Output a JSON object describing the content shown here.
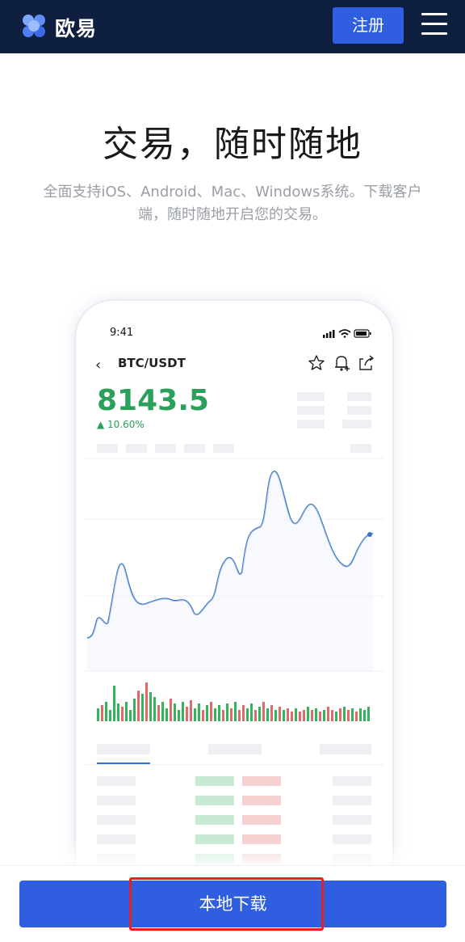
{
  "header": {
    "logo_text": "欧易",
    "register_label": "注册",
    "menu_icon": "hamburger-menu-icon"
  },
  "hero": {
    "title": "交易，随时随地",
    "subtitle": "全面支持iOS、Android、Mac、Windows系统。下载客户端，随时随地开启您的交易。"
  },
  "phone": {
    "time": "9:41",
    "pair": "BTC/USDT",
    "price": "8143.5",
    "change": "▲ 10.60%",
    "colors": {
      "up": "#2ba05b",
      "line": "#3a73c6"
    },
    "icons": [
      "back-chevron-icon",
      "star-icon",
      "bell-plus-icon",
      "share-icon"
    ]
  },
  "bottom": {
    "download_label": "本地下载",
    "accent": "#2f5fe0",
    "highlight_color": "#e3221c"
  }
}
